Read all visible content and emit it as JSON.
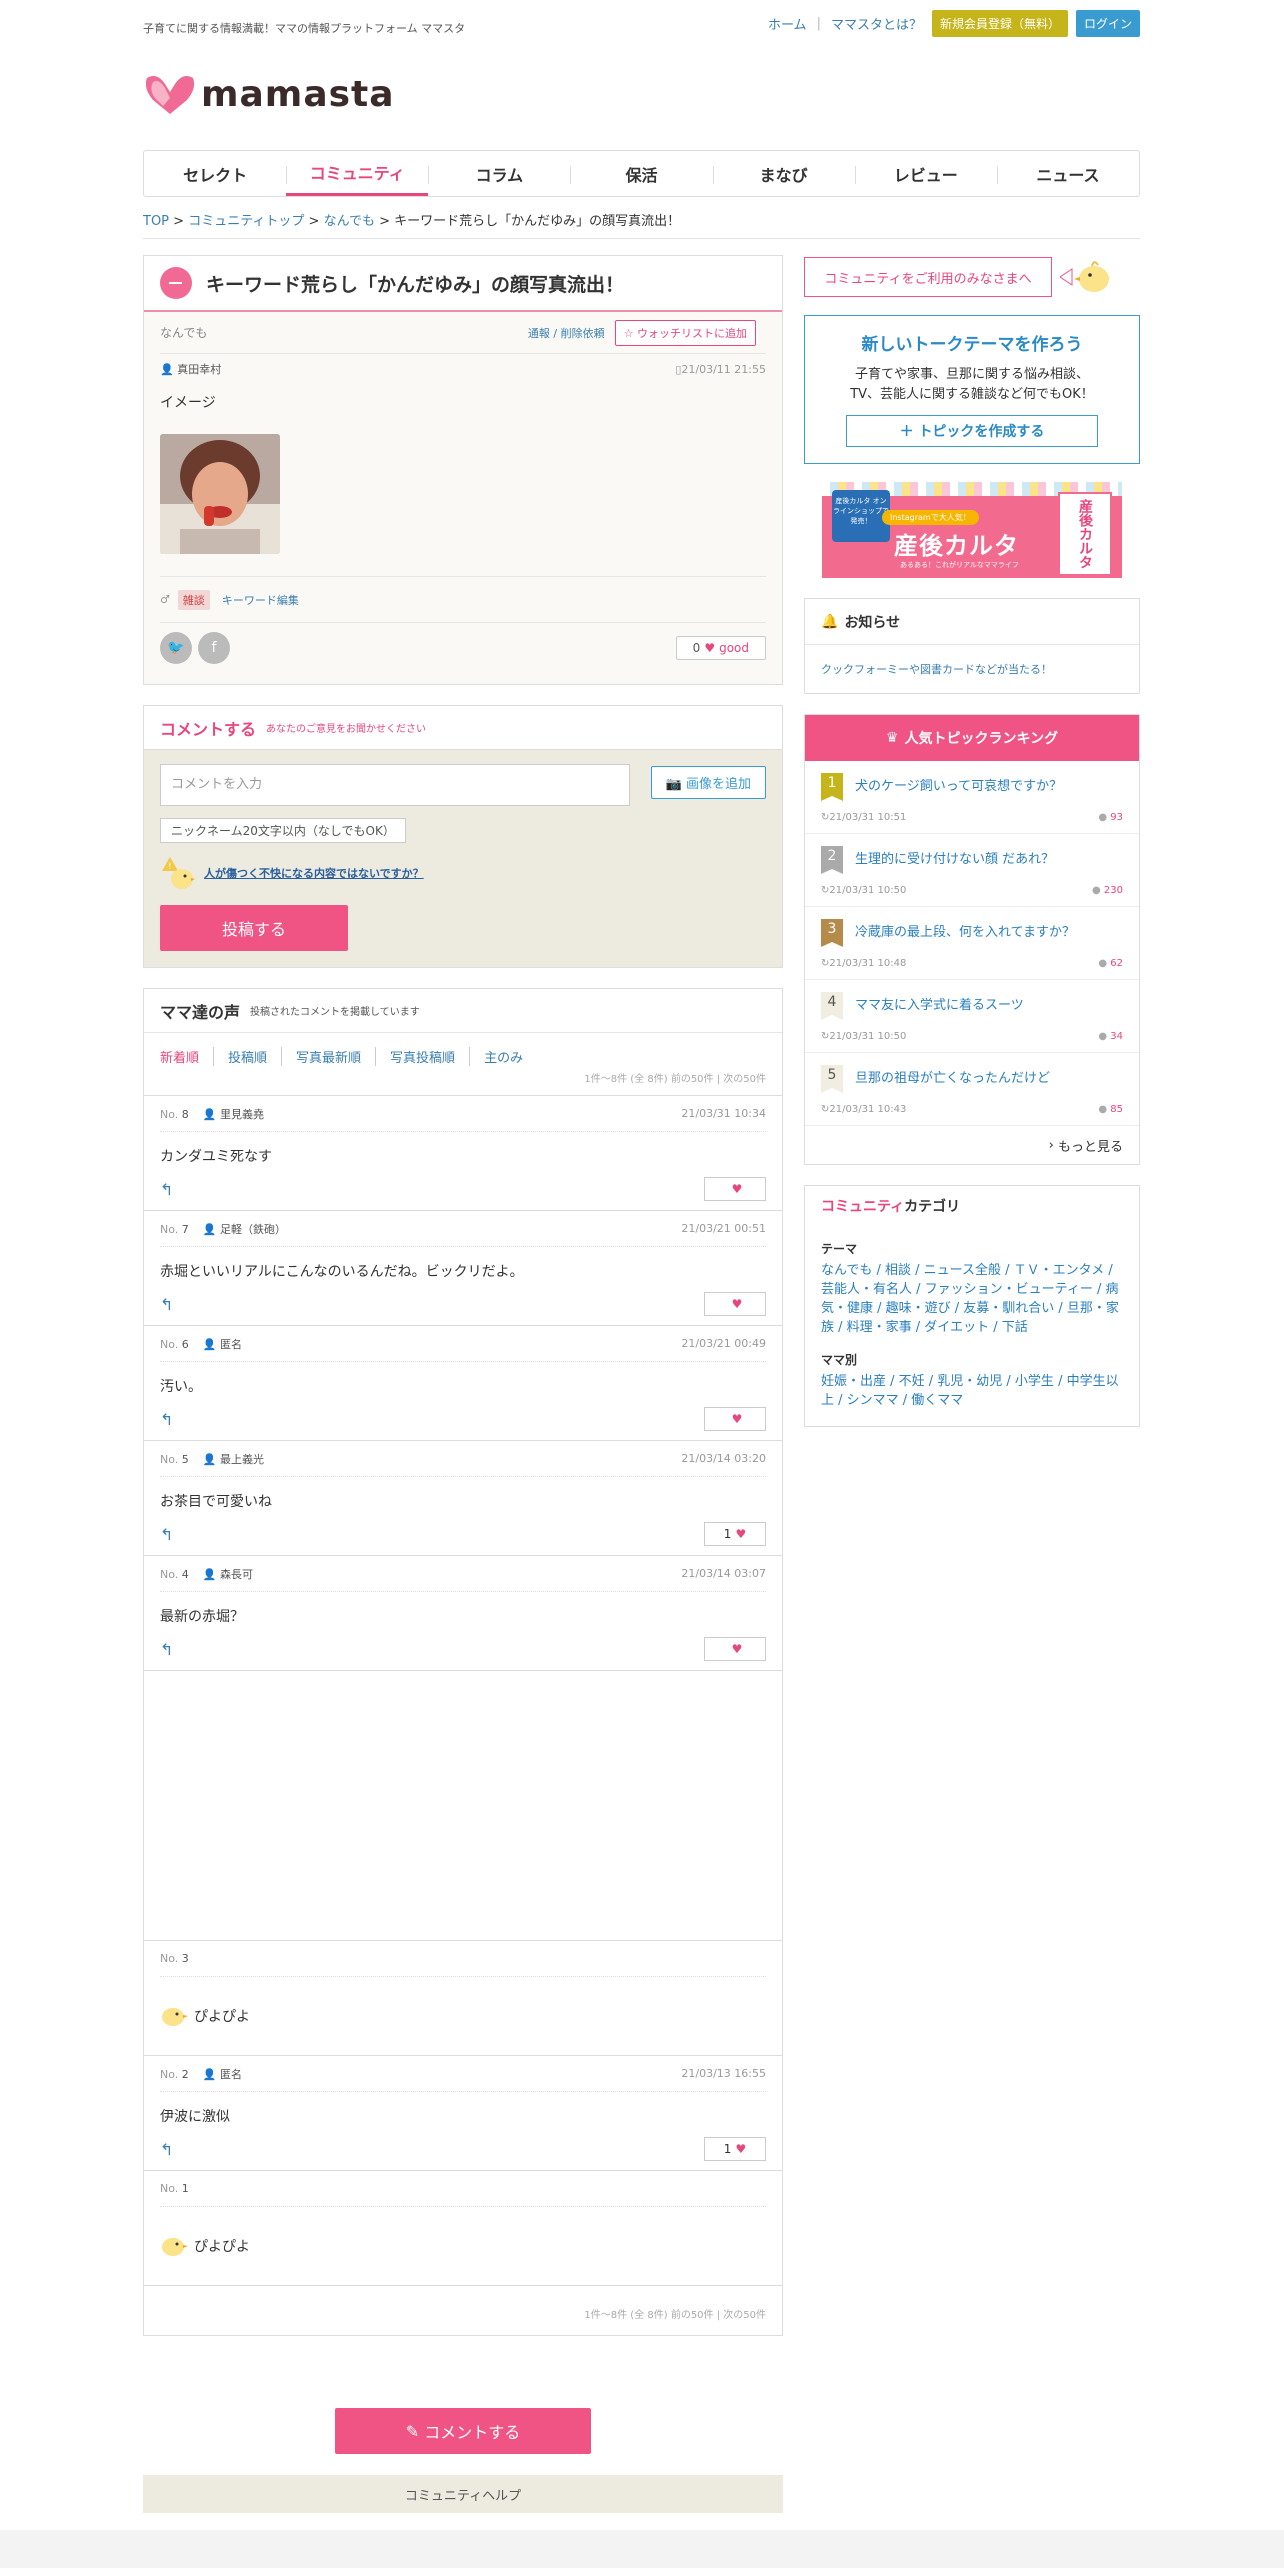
{
  "header": {
    "tagline": "子育てに関する情報満載！ママの情報プラットフォーム ママスタ",
    "links": [
      "ホーム",
      "ママスタとは？"
    ],
    "register": "新規会員登録（無料）",
    "login": "ログイン",
    "logo": "mamasta"
  },
  "nav": [
    "セレクト",
    "コミュニティ",
    "コラム",
    "保活",
    "まなび",
    "レビュー",
    "ニュース"
  ],
  "breadcrumb": [
    "TOP",
    "コミュニティトップ",
    "なんでも",
    "キーワード荒らし「かんだゆみ」の顔写真流出！"
  ],
  "topic": {
    "title": "キーワード荒らし「かんだゆみ」の顔写真流出！",
    "category": "なんでも",
    "report": "通報 / 削除依頼",
    "watch": "ウォッチリストに追加",
    "author": "真田幸村",
    "date": "21/03/11 21:55",
    "text": "イメージ",
    "tag": "雑談",
    "tag_edit": "キーワード編集",
    "good_count": "0",
    "good_label": "good"
  },
  "comment_form": {
    "title": "コメントする",
    "subtitle": "あなたのご意見をお聞かせください",
    "placeholder": "コメントを入力",
    "image_button": "画像を追加",
    "nickname": "ニックネーム20文字以内（なしでもOK）",
    "warning": "人が傷つく不快になる内容ではないですか？",
    "submit": "投稿する"
  },
  "comments_section": {
    "title": "ママ達の声",
    "subtitle": "投稿されたコメントを掲載しています",
    "sort": [
      "新着順",
      "投稿順",
      "写真最新順",
      "写真投稿順",
      "主のみ"
    ],
    "pager": "1件～8件 (全 8件) 前の50件 | 次の50件",
    "no_label": "No."
  },
  "comments": [
    {
      "no": "8",
      "user": "里見義堯",
      "date": "21/03/31 10:34",
      "text": "カンダユミ死なす",
      "likes": ""
    },
    {
      "no": "7",
      "user": "足軽（鉄砲）",
      "date": "21/03/21 00:51",
      "text": "赤堀といいリアルにこんなのいるんだね。ビックリだよ。",
      "likes": ""
    },
    {
      "no": "6",
      "user": "匿名",
      "date": "21/03/21 00:49",
      "text": "汚い。",
      "likes": ""
    },
    {
      "no": "5",
      "user": "最上義光",
      "date": "21/03/14 03:20",
      "text": "お茶目で可愛いね",
      "likes": "1"
    },
    {
      "no": "4",
      "user": "森長可",
      "date": "21/03/14 03:07",
      "text": "最新の赤堀？",
      "likes": ""
    }
  ],
  "deleted_3": {
    "no": "3",
    "text": "ぴよぴよ"
  },
  "comment_2": {
    "no": "2",
    "user": "匿名",
    "date": "21/03/13 16:55",
    "text": "伊波に激似",
    "likes": "1"
  },
  "deleted_1": {
    "no": "1",
    "text": "ぴよぴよ"
  },
  "bottom": {
    "comment_button": "コメントする",
    "help": "コミュニティヘルプ"
  },
  "sidebar": {
    "welcome": "コミュニティをご利用のみなさまへ",
    "new_topic_title": "新しいトークテーマを作ろう",
    "new_topic_desc1": "子育てや家事、旦那に関する悩み相談、",
    "new_topic_desc2": "TV、芸能人に関する雑談など何でもOK！",
    "new_topic_button": "トピックを作成する",
    "banner": {
      "badge": "産後カルタ オンラインショップで 発売！",
      "ribbon": "Instagramで大人気！",
      "title": "産後カルタ",
      "sub": "あるある！これがリアルなママライフ",
      "box": "産後カルタ"
    },
    "notice_title": "お知らせ",
    "notice_text": "クックフォーミーや図書カードなどが当たる！",
    "ranking_title": "人気トピックランキング",
    "ranking": [
      {
        "rank": "1",
        "title": "犬のケージ飼いって可哀想ですか？",
        "date": "21/03/31 10:51",
        "count": "93",
        "color": "#c5b41a"
      },
      {
        "rank": "2",
        "title": "生理的に受け付けない顔 だあれ？",
        "date": "21/03/31 10:50",
        "count": "230",
        "color": "#aaaaaa"
      },
      {
        "rank": "3",
        "title": "冷蔵庫の最上段、何を入れてますか？",
        "date": "21/03/31 10:48",
        "count": "62",
        "color": "#b58a4a"
      },
      {
        "rank": "4",
        "title": "ママ友に入学式に着るスーツ",
        "date": "21/03/31 10:50",
        "count": "34",
        "color": "#f1ede0"
      },
      {
        "rank": "5",
        "title": "旦那の祖母が亡くなったんだけど",
        "date": "21/03/31 10:43",
        "count": "85",
        "color": "#f1ede0"
      }
    ],
    "ranking_more": "もっと見る",
    "category_title_pink": "コミュニティ",
    "category_title_rest": "カテゴリ",
    "theme_label": "テーマ",
    "theme_links": "なんでも / 相談 / ニュース全般 / ＴＶ・エンタメ / 芸能人・有名人 / ファッション・ビューティー / 病気・健康 / 趣味・遊び / 友募・馴れ合い / 旦那・家族 / 料理・家事 / ダイエット / 下話",
    "mama_label": "ママ別",
    "mama_links": "妊娠・出産 / 不妊 / 乳児・幼児 / 小学生 / 中学生以上 / シンママ / 働くママ"
  }
}
